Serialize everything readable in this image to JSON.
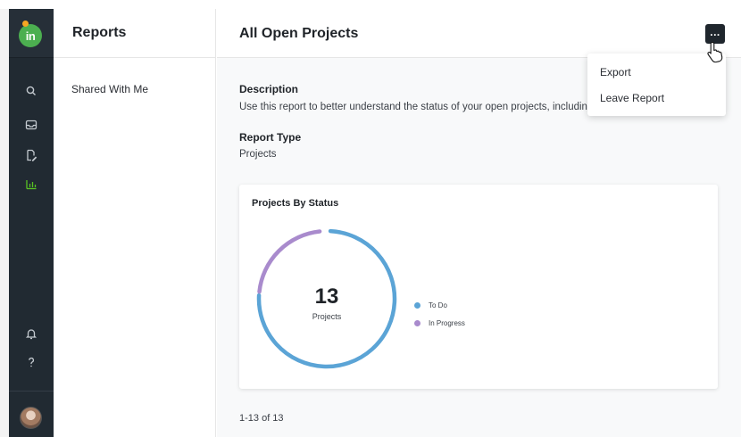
{
  "app": {
    "logo_text": "in",
    "brand_color": "#4caf50",
    "rail_color": "#212a32",
    "active_color": "#58c322"
  },
  "rail": {
    "icons": [
      "search-icon",
      "inbox-icon",
      "document-edit-icon",
      "reports-chart-icon",
      "bell-icon",
      "help-icon"
    ]
  },
  "nav": {
    "title": "Reports",
    "items": [
      {
        "label": "Shared With Me"
      }
    ]
  },
  "main": {
    "title": "All Open Projects",
    "more_label": "...",
    "description_label": "Description",
    "description_text": "Use this report to better understand the status of your open projects, including",
    "report_type_label": "Report Type",
    "report_type_value": "Projects",
    "pager": "1-13 of 13"
  },
  "menu": {
    "items": [
      {
        "label": "Export"
      },
      {
        "label": "Leave Report"
      }
    ]
  },
  "chart": {
    "title": "Projects By Status",
    "total": "13",
    "total_label": "Projects",
    "legend": [
      {
        "label": "To Do",
        "color": "#5ba4d6"
      },
      {
        "label": "In Progress",
        "color": "#a98bcd"
      }
    ]
  }
}
